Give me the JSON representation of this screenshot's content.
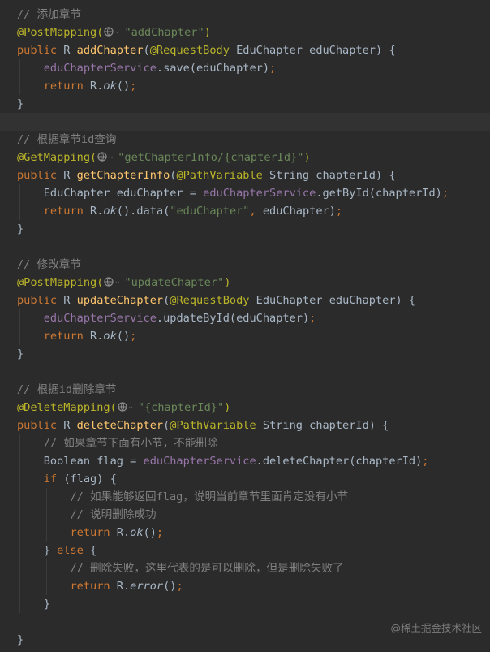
{
  "colors": {
    "background": "#2b2b2b",
    "current_line": "#323232",
    "comment": "#808080",
    "keyword": "#cc7832",
    "annotation": "#bbb529",
    "string": "#6a8759",
    "field": "#9876aa",
    "plain": "#a9b7c6",
    "method_decl": "#ffc66d"
  },
  "icons": {
    "mapping_icon": "globe-with-dropdown-icon"
  },
  "watermark": "@稀土掘金技术社区",
  "lines": [
    [
      {
        "t": "// 添加章节",
        "c": "c"
      }
    ],
    [
      {
        "t": "@PostMapping(",
        "c": "an"
      },
      {
        "icon": "globe"
      },
      {
        "t": "\"",
        "c": "st"
      },
      {
        "t": "addChapter",
        "c": "st ul"
      },
      {
        "t": "\"",
        "c": "st"
      },
      {
        "t": ")",
        "c": "an"
      }
    ],
    [
      {
        "t": "public ",
        "c": "kw"
      },
      {
        "t": "R ",
        "c": "plain"
      },
      {
        "t": "addChapter",
        "c": "fn"
      },
      {
        "t": "(",
        "c": "plain"
      },
      {
        "t": "@RequestBody ",
        "c": "an"
      },
      {
        "t": "EduChapter eduChapter) {",
        "c": "plain"
      }
    ],
    [
      {
        "t": "    "
      },
      {
        "t": "eduChapterService",
        "c": "fd"
      },
      {
        "t": ".save(eduChapter)",
        "c": "plain"
      },
      {
        "t": ";",
        "c": "kw"
      }
    ],
    [
      {
        "t": "    "
      },
      {
        "t": "return ",
        "c": "kw"
      },
      {
        "t": "R.",
        "c": "plain"
      },
      {
        "t": "ok",
        "c": "plain it"
      },
      {
        "t": "()",
        "c": "plain"
      },
      {
        "t": ";",
        "c": "kw"
      }
    ],
    [
      {
        "t": "}",
        "c": "plain"
      }
    ],
    [],
    [
      {
        "t": "// 根据章节id查询",
        "c": "c"
      }
    ],
    [
      {
        "t": "@GetMapping(",
        "c": "an"
      },
      {
        "icon": "globe"
      },
      {
        "t": "\"",
        "c": "st"
      },
      {
        "t": "getChapterInfo/{chapterId}",
        "c": "st ul"
      },
      {
        "t": "\"",
        "c": "st"
      },
      {
        "t": ")",
        "c": "an"
      }
    ],
    [
      {
        "t": "public ",
        "c": "kw"
      },
      {
        "t": "R ",
        "c": "plain"
      },
      {
        "t": "getChapterInfo",
        "c": "fn"
      },
      {
        "t": "(",
        "c": "plain"
      },
      {
        "t": "@PathVariable ",
        "c": "an"
      },
      {
        "t": "String chapterId) {",
        "c": "plain"
      }
    ],
    [
      {
        "t": "    "
      },
      {
        "t": "EduChapter eduChapter = ",
        "c": "plain"
      },
      {
        "t": "eduChapterService",
        "c": "fd"
      },
      {
        "t": ".getById(chapterId)",
        "c": "plain"
      },
      {
        "t": ";",
        "c": "kw"
      }
    ],
    [
      {
        "t": "    "
      },
      {
        "t": "return ",
        "c": "kw"
      },
      {
        "t": "R.",
        "c": "plain"
      },
      {
        "t": "ok",
        "c": "plain it"
      },
      {
        "t": "().data(",
        "c": "plain"
      },
      {
        "t": "\"eduChapter\"",
        "c": "st"
      },
      {
        "t": ", ",
        "c": "kw"
      },
      {
        "t": "eduChapter)",
        "c": "plain"
      },
      {
        "t": ";",
        "c": "kw"
      }
    ],
    [
      {
        "t": "}",
        "c": "plain"
      }
    ],
    [],
    [
      {
        "t": "// 修改章节",
        "c": "c"
      }
    ],
    [
      {
        "t": "@PostMapping(",
        "c": "an"
      },
      {
        "icon": "globe"
      },
      {
        "t": "\"",
        "c": "st"
      },
      {
        "t": "updateChapter",
        "c": "st ul"
      },
      {
        "t": "\"",
        "c": "st"
      },
      {
        "t": ")",
        "c": "an"
      }
    ],
    [
      {
        "t": "public ",
        "c": "kw"
      },
      {
        "t": "R ",
        "c": "plain"
      },
      {
        "t": "updateChapter",
        "c": "fn"
      },
      {
        "t": "(",
        "c": "plain"
      },
      {
        "t": "@RequestBody ",
        "c": "an"
      },
      {
        "t": "EduChapter eduChapter) {",
        "c": "plain"
      }
    ],
    [
      {
        "t": "    "
      },
      {
        "t": "eduChapterService",
        "c": "fd"
      },
      {
        "t": ".updateById(eduChapter)",
        "c": "plain"
      },
      {
        "t": ";",
        "c": "kw"
      }
    ],
    [
      {
        "t": "    "
      },
      {
        "t": "return ",
        "c": "kw"
      },
      {
        "t": "R.",
        "c": "plain"
      },
      {
        "t": "ok",
        "c": "plain it"
      },
      {
        "t": "()",
        "c": "plain"
      },
      {
        "t": ";",
        "c": "kw"
      }
    ],
    [
      {
        "t": "}",
        "c": "plain"
      }
    ],
    [],
    [
      {
        "t": "// 根据id删除章节",
        "c": "c"
      }
    ],
    [
      {
        "t": "@DeleteMapping(",
        "c": "an"
      },
      {
        "icon": "globe"
      },
      {
        "t": "\"",
        "c": "st"
      },
      {
        "t": "{chapterId}",
        "c": "st ul"
      },
      {
        "t": "\"",
        "c": "st"
      },
      {
        "t": ")",
        "c": "an"
      }
    ],
    [
      {
        "t": "public ",
        "c": "kw"
      },
      {
        "t": "R ",
        "c": "plain"
      },
      {
        "t": "deleteChapter",
        "c": "fn"
      },
      {
        "t": "(",
        "c": "plain"
      },
      {
        "t": "@PathVariable ",
        "c": "an"
      },
      {
        "t": "String chapterId) {",
        "c": "plain"
      }
    ],
    [
      {
        "t": "    "
      },
      {
        "t": "// 如果章节下面有小节，不能删除",
        "c": "c"
      }
    ],
    [
      {
        "t": "    "
      },
      {
        "t": "Boolean flag = ",
        "c": "plain"
      },
      {
        "t": "eduChapterService",
        "c": "fd"
      },
      {
        "t": ".deleteChapter(chapterId)",
        "c": "plain"
      },
      {
        "t": ";",
        "c": "kw"
      }
    ],
    [
      {
        "t": "    "
      },
      {
        "t": "if ",
        "c": "kw"
      },
      {
        "t": "(flag) {",
        "c": "plain"
      }
    ],
    [
      {
        "t": "        "
      },
      {
        "t": "// 如果能够返回flag，说明当前章节里面肯定没有小节",
        "c": "c"
      }
    ],
    [
      {
        "t": "        "
      },
      {
        "t": "// 说明删除成功",
        "c": "c"
      }
    ],
    [
      {
        "t": "        "
      },
      {
        "t": "return ",
        "c": "kw"
      },
      {
        "t": "R.",
        "c": "plain"
      },
      {
        "t": "ok",
        "c": "plain it"
      },
      {
        "t": "()",
        "c": "plain"
      },
      {
        "t": ";",
        "c": "kw"
      }
    ],
    [
      {
        "t": "    "
      },
      {
        "t": "} ",
        "c": "plain"
      },
      {
        "t": "else ",
        "c": "kw"
      },
      {
        "t": "{",
        "c": "plain"
      }
    ],
    [
      {
        "t": "        "
      },
      {
        "t": "// 删除失败，这里代表的是可以删除，但是删除失败了",
        "c": "c"
      }
    ],
    [
      {
        "t": "        "
      },
      {
        "t": "return ",
        "c": "kw"
      },
      {
        "t": "R.",
        "c": "plain"
      },
      {
        "t": "error",
        "c": "plain it"
      },
      {
        "t": "()",
        "c": "plain"
      },
      {
        "t": ";",
        "c": "kw"
      }
    ],
    [
      {
        "t": "    "
      },
      {
        "t": "}",
        "c": "plain"
      }
    ],
    [],
    [
      {
        "t": "}",
        "c": "plain"
      }
    ]
  ]
}
